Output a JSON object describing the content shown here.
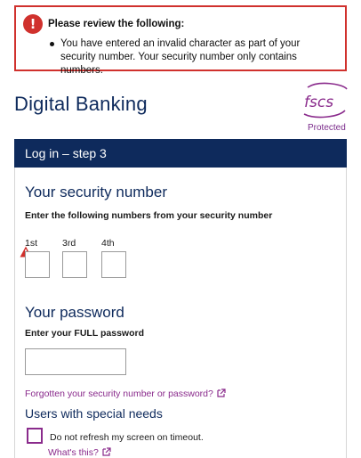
{
  "error": {
    "title": "Please review the following:",
    "items": [
      "You have entered an invalid character as part of your security number. Your security number only contains numbers."
    ],
    "icon": "exclamation-circle-icon",
    "color": "#d0312d"
  },
  "brand": {
    "title": "Digital Banking",
    "fscs_logo_text": "fscs",
    "fscs_protected": "Protected"
  },
  "panel": {
    "header": "Log in – step 3"
  },
  "security_number": {
    "heading": "Your security number",
    "instruction": "Enter the following numbers from your security number",
    "digits": [
      {
        "label": "1st",
        "value": "",
        "error": true
      },
      {
        "label": "3rd",
        "value": "",
        "error": false
      },
      {
        "label": "4th",
        "value": "",
        "error": false
      }
    ]
  },
  "password": {
    "heading": "Your password",
    "instruction": "Enter your FULL password",
    "value": ""
  },
  "forgotten_link": "Forgotten your security number or password?",
  "special_needs": {
    "heading": "Users with special needs",
    "checkbox_label": "Do not refresh my screen on timeout.",
    "checked": false,
    "whats_this": "What's this?"
  },
  "colors": {
    "navy": "#0e2a5c",
    "purple": "#8a2b8c",
    "error": "#d0312d"
  }
}
